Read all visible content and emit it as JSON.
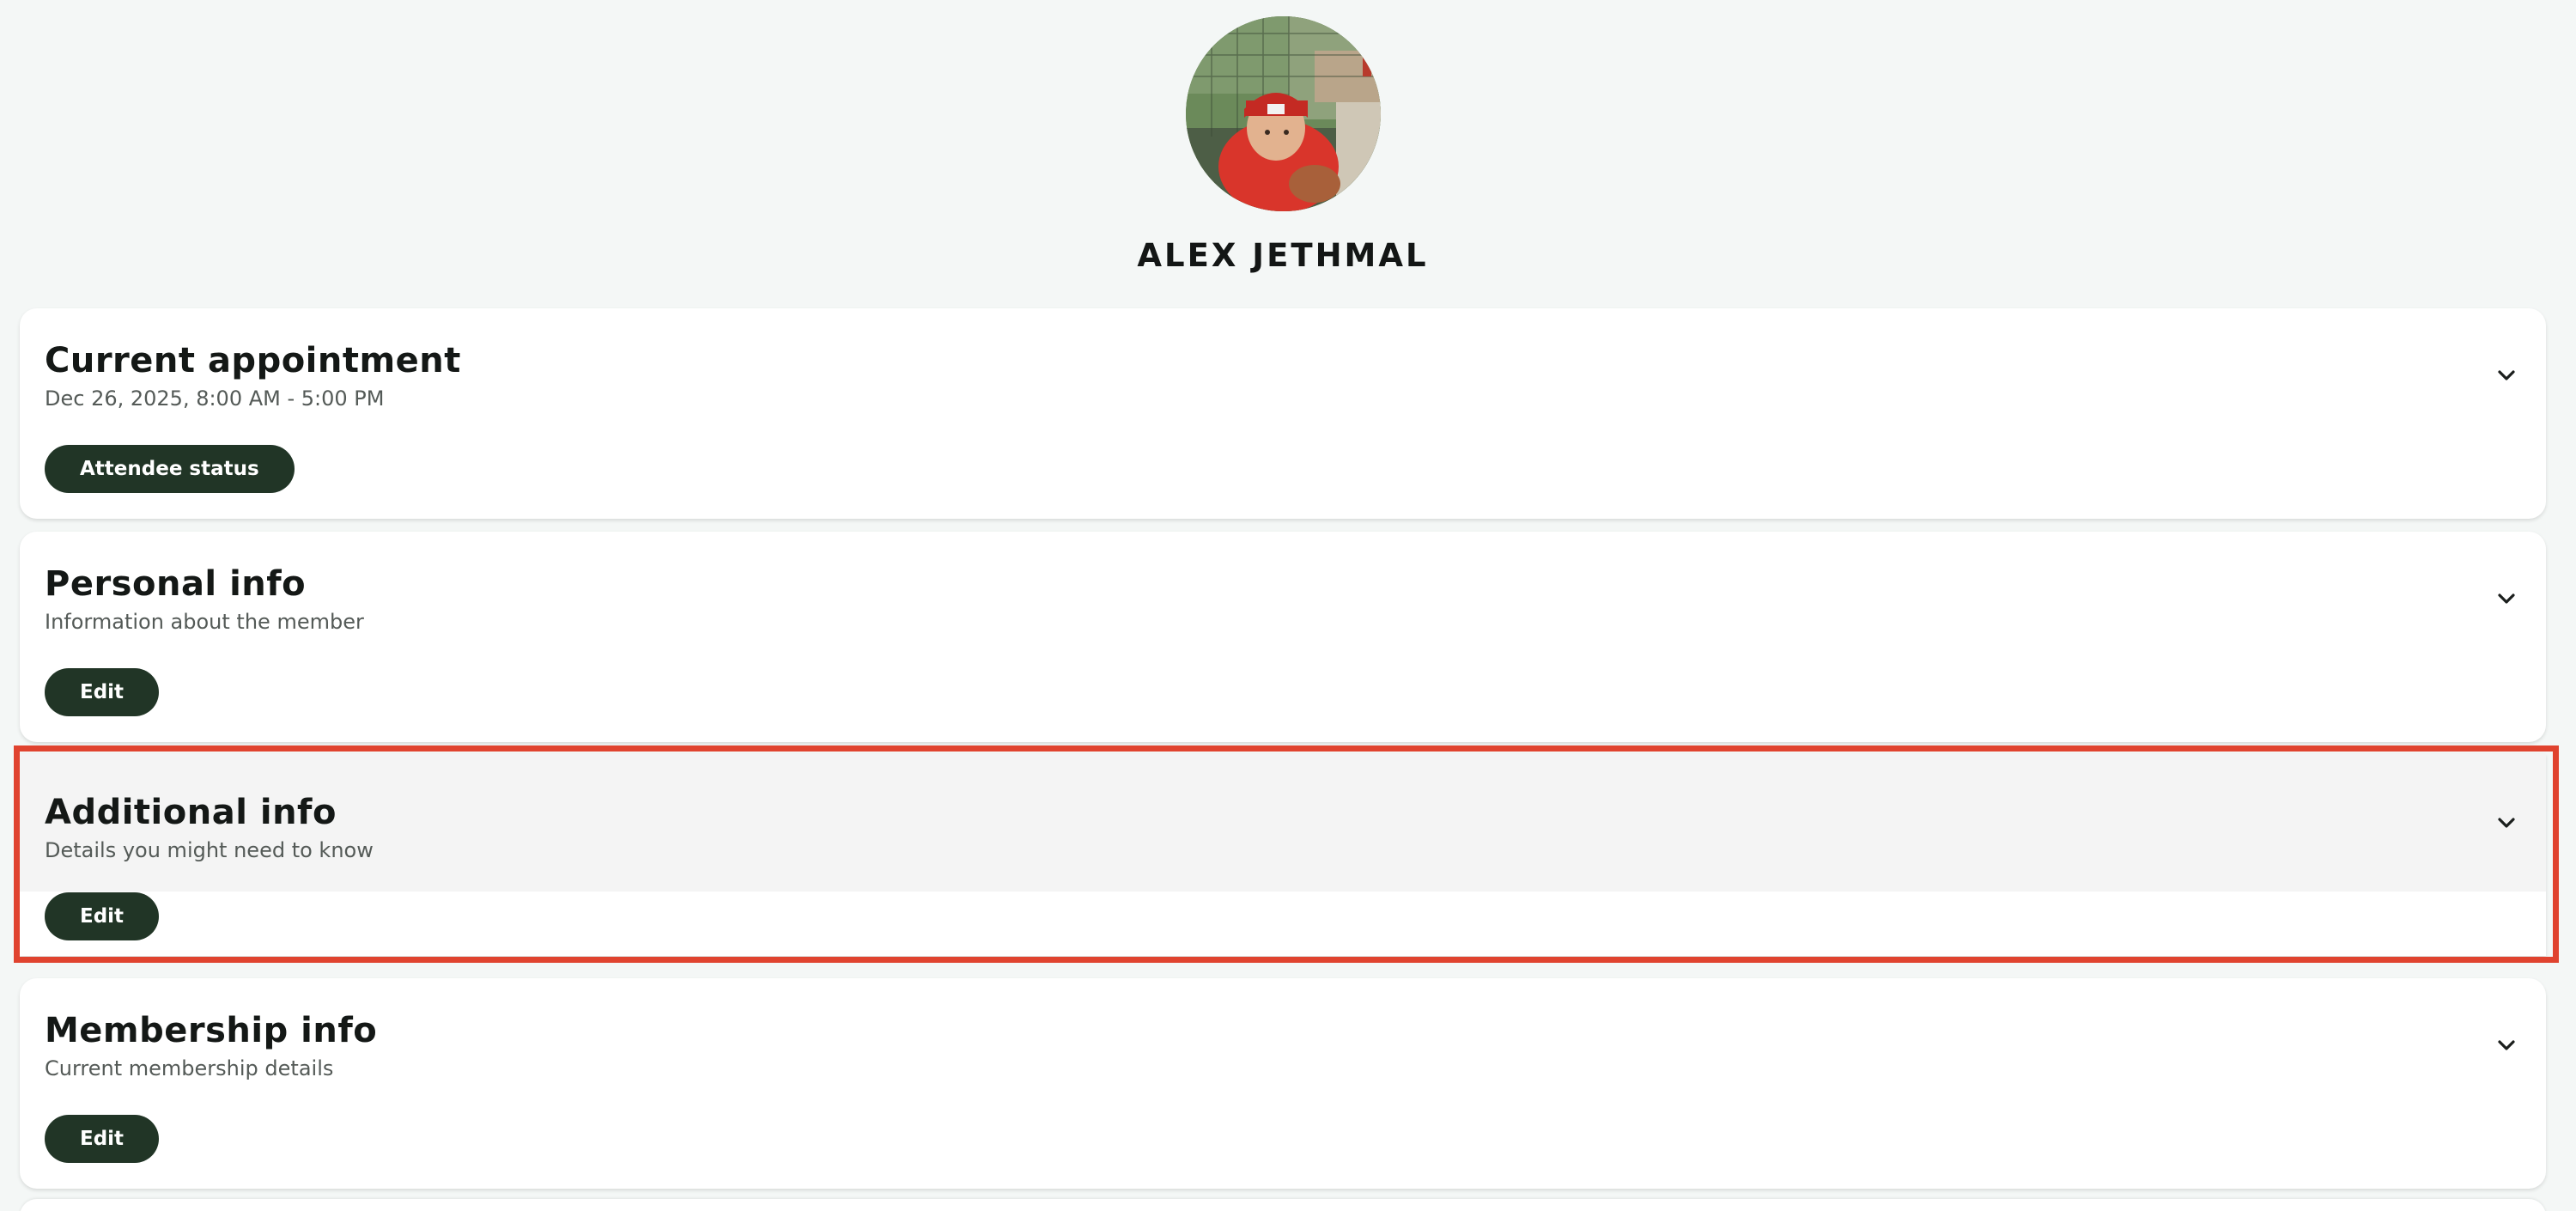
{
  "member": {
    "name": "ALEX JETHMAL"
  },
  "cards": [
    {
      "title": "Current appointment",
      "subtitle": "Dec 26, 2025, 8:00 AM - 5:00 PM",
      "button": "Attendee status"
    },
    {
      "title": "Personal info",
      "subtitle": "Information about the member",
      "button": "Edit"
    },
    {
      "title": "Additional info",
      "subtitle": "Details you might need to know",
      "button": "Edit"
    },
    {
      "title": "Membership info",
      "subtitle": "Current membership details",
      "button": "Edit"
    }
  ],
  "icons": {
    "expand": "chevron-down-icon"
  },
  "colors": {
    "background": "#f4f7f6",
    "button": "#213526",
    "highlight_border": "#e0432f"
  }
}
